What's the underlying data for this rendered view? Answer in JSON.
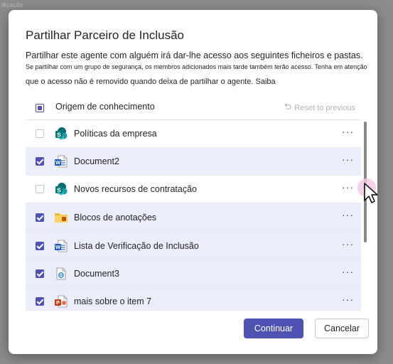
{
  "backdrop": {
    "corner_text": "ificação"
  },
  "dialog": {
    "title": "Partilhar Parceiro de Inclusão",
    "desc_line1": "Partilhar este agente com alguém irá dar-lhe acesso aos seguintes ficheiros e pastas.",
    "desc_line2": "Se partilhar com um grupo de segurança, os membros adicionados mais tarde também terão acesso. Tenha em atenção",
    "desc_line3": "que o acesso não é removido quando deixa de partilhar o agente. Saiba"
  },
  "table": {
    "header_label": "Origem de conhecimento",
    "reset_label": "Reset to previous",
    "rows": [
      {
        "name": "Políticas da empresa",
        "checked": false,
        "icon": "sharepoint-icon"
      },
      {
        "name": "Document2",
        "checked": true,
        "icon": "word-icon"
      },
      {
        "name": "Novos recursos de contratação",
        "checked": false,
        "icon": "sharepoint-icon"
      },
      {
        "name": "Blocos de anotações",
        "checked": true,
        "icon": "folder-icon"
      },
      {
        "name": "Lista de Verificação de Inclusão",
        "checked": true,
        "icon": "word-icon"
      },
      {
        "name": "Document3",
        "checked": true,
        "icon": "web-page-icon"
      },
      {
        "name": "mais sobre o item 7",
        "checked": true,
        "icon": "powerpoint-icon"
      }
    ]
  },
  "buttons": {
    "continue": "Continuar",
    "cancel": "Cancelar"
  },
  "colors": {
    "accent": "#4f52b2",
    "selected_row": "#ebedf8"
  }
}
